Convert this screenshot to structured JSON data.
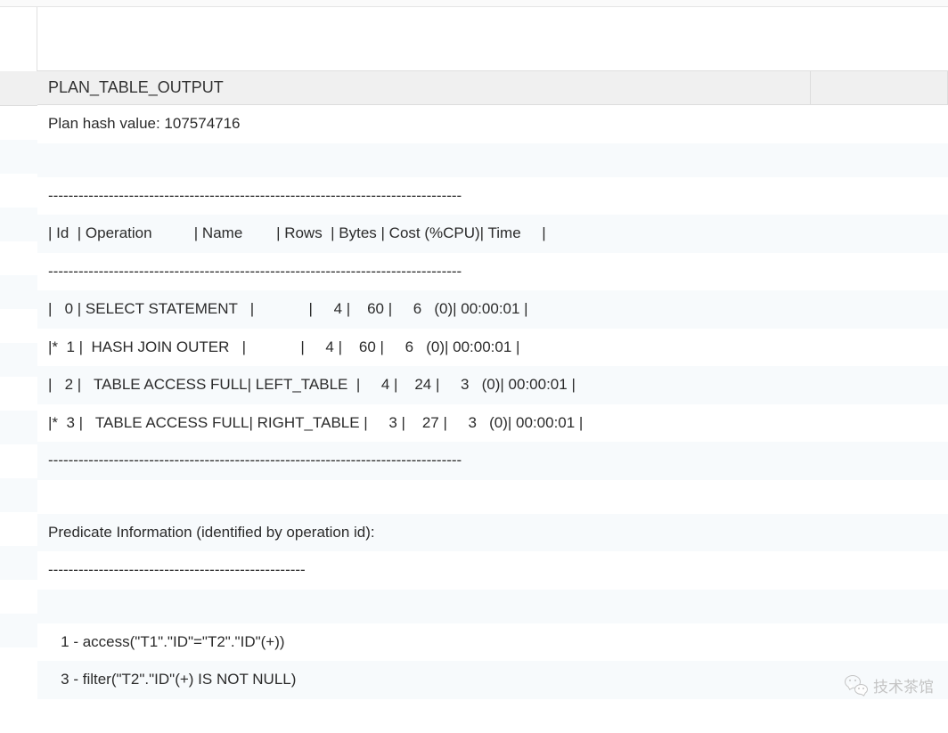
{
  "header": {
    "column_title": "PLAN_TABLE_OUTPUT"
  },
  "rows": [
    "Plan hash value: 107574716",
    "",
    "----------------------------------------------------------------------------------",
    "| Id  | Operation          | Name        | Rows  | Bytes | Cost (%CPU)| Time     |",
    "----------------------------------------------------------------------------------",
    "|   0 | SELECT STATEMENT   |             |     4 |    60 |     6   (0)| 00:00:01 |",
    "|*  1 |  HASH JOIN OUTER   |             |     4 |    60 |     6   (0)| 00:00:01 |",
    "|   2 |   TABLE ACCESS FULL| LEFT_TABLE  |     4 |    24 |     3   (0)| 00:00:01 |",
    "|*  3 |   TABLE ACCESS FULL| RIGHT_TABLE |     3 |    27 |     3   (0)| 00:00:01 |",
    "----------------------------------------------------------------------------------",
    "",
    "Predicate Information (identified by operation id):",
    "---------------------------------------------------",
    "",
    "   1 - access(\"T1\".\"ID\"=\"T2\".\"ID\"(+))",
    "   3 - filter(\"T2\".\"ID\"(+) IS NOT NULL)",
    ""
  ],
  "watermark": {
    "text": "技术茶馆"
  }
}
